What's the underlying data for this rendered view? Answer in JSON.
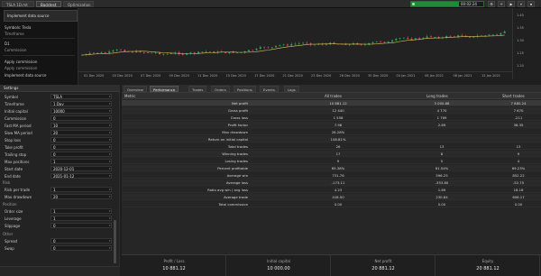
{
  "topbar": {
    "tabs": [
      {
        "label": "TSLA 1D.mt",
        "active": false
      },
      {
        "label": "Backtest",
        "active": true
      },
      {
        "label": "Optimization",
        "active": false
      }
    ],
    "progress": {
      "percent": 0.66,
      "label": "00:02:24"
    },
    "controls": [
      "⚙",
      "+",
      "▶",
      "⏸",
      "⏹"
    ]
  },
  "sidebar": {
    "popup": "Implement data source",
    "items": [
      "Symbols: Tesla",
      "Timeframe",
      "D1",
      "Commission",
      "Apply commission",
      "Apply commission",
      "Implement data source"
    ]
  },
  "chart": {
    "price_ticks": [
      "1.40",
      "1.35",
      "1.30",
      "1.25",
      "1.20"
    ],
    "time_ticks": [
      "01 Dec 2020",
      "03 Dec 2020",
      "07 Dec 2020",
      "09 Dec 2020",
      "11 Dec 2020",
      "15 Dec 2020",
      "17 Dec 2020",
      "21 Dec 2020",
      "23 Dec 2020",
      "28 Dec 2020",
      "30 Dec 2020",
      "04 Jan 2021",
      "06 Jan 2021",
      "08 Jan 2021",
      "12 Jan 2021"
    ],
    "colors": {
      "up": "#26a65b",
      "down": "#d9534f",
      "ma": "#e0c060"
    }
  },
  "left_panel": {
    "header": "Settings",
    "rows": [
      {
        "label": "Symbol",
        "value": "TSLA"
      },
      {
        "label": "Timeframe",
        "value": "1 Day"
      },
      {
        "label": "Initial capital",
        "value": "10000"
      },
      {
        "label": "Commission",
        "value": "0"
      },
      {
        "label": "Fast MA period",
        "value": "10"
      },
      {
        "label": "Slow MA period",
        "value": "20"
      },
      {
        "label": "Stop loss",
        "value": "0"
      },
      {
        "label": "Take profit",
        "value": "0"
      },
      {
        "label": "Trailing stop",
        "value": "0"
      },
      {
        "label": "Max positions",
        "value": "1"
      },
      {
        "label": "Start date",
        "value": "2020-12-01"
      },
      {
        "label": "End date",
        "value": "2021-01-12"
      }
    ],
    "section2": "Risk",
    "rows2": [
      {
        "label": "Risk per trade",
        "value": "1"
      },
      {
        "label": "Max drawdown",
        "value": "20"
      }
    ],
    "section3": "Position",
    "rows3": [
      {
        "label": "Order size",
        "value": "1"
      },
      {
        "label": "Leverage",
        "value": "1"
      },
      {
        "label": "Slippage",
        "value": "0"
      }
    ],
    "section4": "Other",
    "rows4": [
      {
        "label": "Spread",
        "value": "0"
      },
      {
        "label": "Swap",
        "value": "0"
      }
    ]
  },
  "results": {
    "tabs": [
      "Overview",
      "Performance",
      "Trades",
      "Orders",
      "Positions",
      "Events",
      "Logs"
    ],
    "headers": [
      "Metric",
      "All trades",
      "Long trades",
      "Short trades"
    ],
    "rows": [
      {
        "metric": "Net profit",
        "c1": "10 881.12",
        "c2": "3 000.88",
        "c3": "7 880.24",
        "hl": true
      },
      {
        "metric": "Gross profit",
        "c1": "12 440",
        "c2": "4 770",
        "c3": "7 670"
      },
      {
        "metric": "Gross loss",
        "c1": "1 558",
        "c2": "1 769",
        "c3": "-211"
      },
      {
        "metric": "Profit factor",
        "c1": "7.98",
        "c2": "2.69",
        "c3": "36.35"
      },
      {
        "metric": "Max drawdown",
        "c1": "28.28%",
        "c2": "",
        "c3": ""
      },
      {
        "metric": "Return on initial capital",
        "c1": "108.81%",
        "c2": "",
        "c3": ""
      },
      {
        "metric": "Total trades",
        "c1": "26",
        "c2": "13",
        "c3": "13"
      },
      {
        "metric": "Winning trades",
        "c1": "17",
        "c2": "8",
        "c3": "9"
      },
      {
        "metric": "Losing trades",
        "c1": "9",
        "c2": "5",
        "c3": "4"
      },
      {
        "metric": "Percent profitable",
        "c1": "65.38%",
        "c2": "61.54%",
        "c3": "69.23%"
      },
      {
        "metric": "Average win",
        "c1": "731.76",
        "c2": "596.25",
        "c3": "852.22"
      },
      {
        "metric": "Average loss",
        "c1": "-173.11",
        "c2": "-353.80",
        "c3": "-52.75"
      },
      {
        "metric": "Ratio avg win / avg loss",
        "c1": "4.23",
        "c2": "1.69",
        "c3": "16.16"
      },
      {
        "metric": "Average trade",
        "c1": "418.50",
        "c2": "230.84",
        "c3": "606.17"
      },
      {
        "metric": "Total commission",
        "c1": "0.00",
        "c2": "0.00",
        "c3": "0.00"
      }
    ],
    "footer": [
      {
        "label": "Profit / Loss",
        "value": "10 881.12"
      },
      {
        "label": "Initial capital",
        "value": "10 000.00"
      },
      {
        "label": "Net profit",
        "value": "20 881.12"
      },
      {
        "label": "Equity",
        "value": "20 881.12"
      }
    ]
  }
}
